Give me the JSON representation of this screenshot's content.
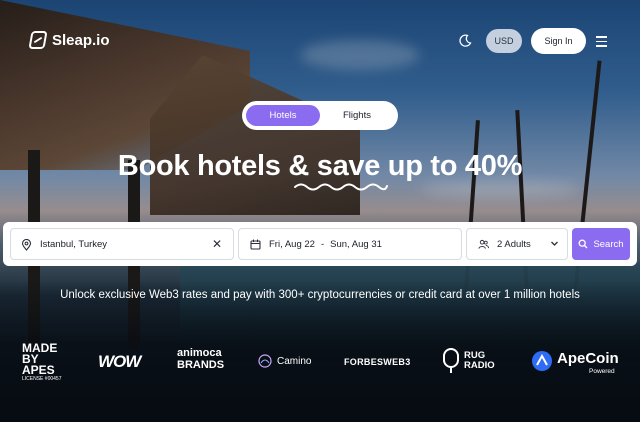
{
  "brand": {
    "name": "Sleap.io"
  },
  "header": {
    "theme_icon": "moon-icon",
    "currency": "USD",
    "signin_label": "Sign In",
    "menu_icon": "hamburger-menu-icon"
  },
  "tabs": [
    {
      "label": "Hotels",
      "active": true
    },
    {
      "label": "Flights",
      "active": false
    }
  ],
  "headline": "Book hotels & save up to 40%",
  "search": {
    "destination_icon": "location-pin-icon",
    "destination": "Istanbul, Turkey",
    "clear_icon": "close-icon",
    "dates_icon": "calendar-icon",
    "check_in": "Fri, Aug 22",
    "date_separator": "-",
    "check_out": "Sun, Aug 31",
    "guests_icon": "users-icon",
    "guests": "2 Adults",
    "guests_chevron": "chevron-down-icon",
    "search_icon": "search-icon",
    "search_label": "Search"
  },
  "tagline": "Unlock exclusive Web3 rates and pay with 300+ cryptocurrencies or credit card at over 1 million hotels",
  "partners": {
    "made_by_apes": {
      "line1": "MADE",
      "line2": "BY APES",
      "license": "LICENSE #00457"
    },
    "wow": "WOW",
    "animoca": {
      "line1": "animoca",
      "line2": "BRANDS"
    },
    "camino": "Camino",
    "forbes": "FORBESWEB3",
    "rug_radio": {
      "line1": "RUG",
      "line2": "RADIO"
    },
    "apecoin": {
      "name": "ApeCoin",
      "sub": "Powered"
    }
  },
  "colors": {
    "accent": "#8b6cf0",
    "surface": "#ffffff",
    "text_dark": "#1b1f2a"
  }
}
